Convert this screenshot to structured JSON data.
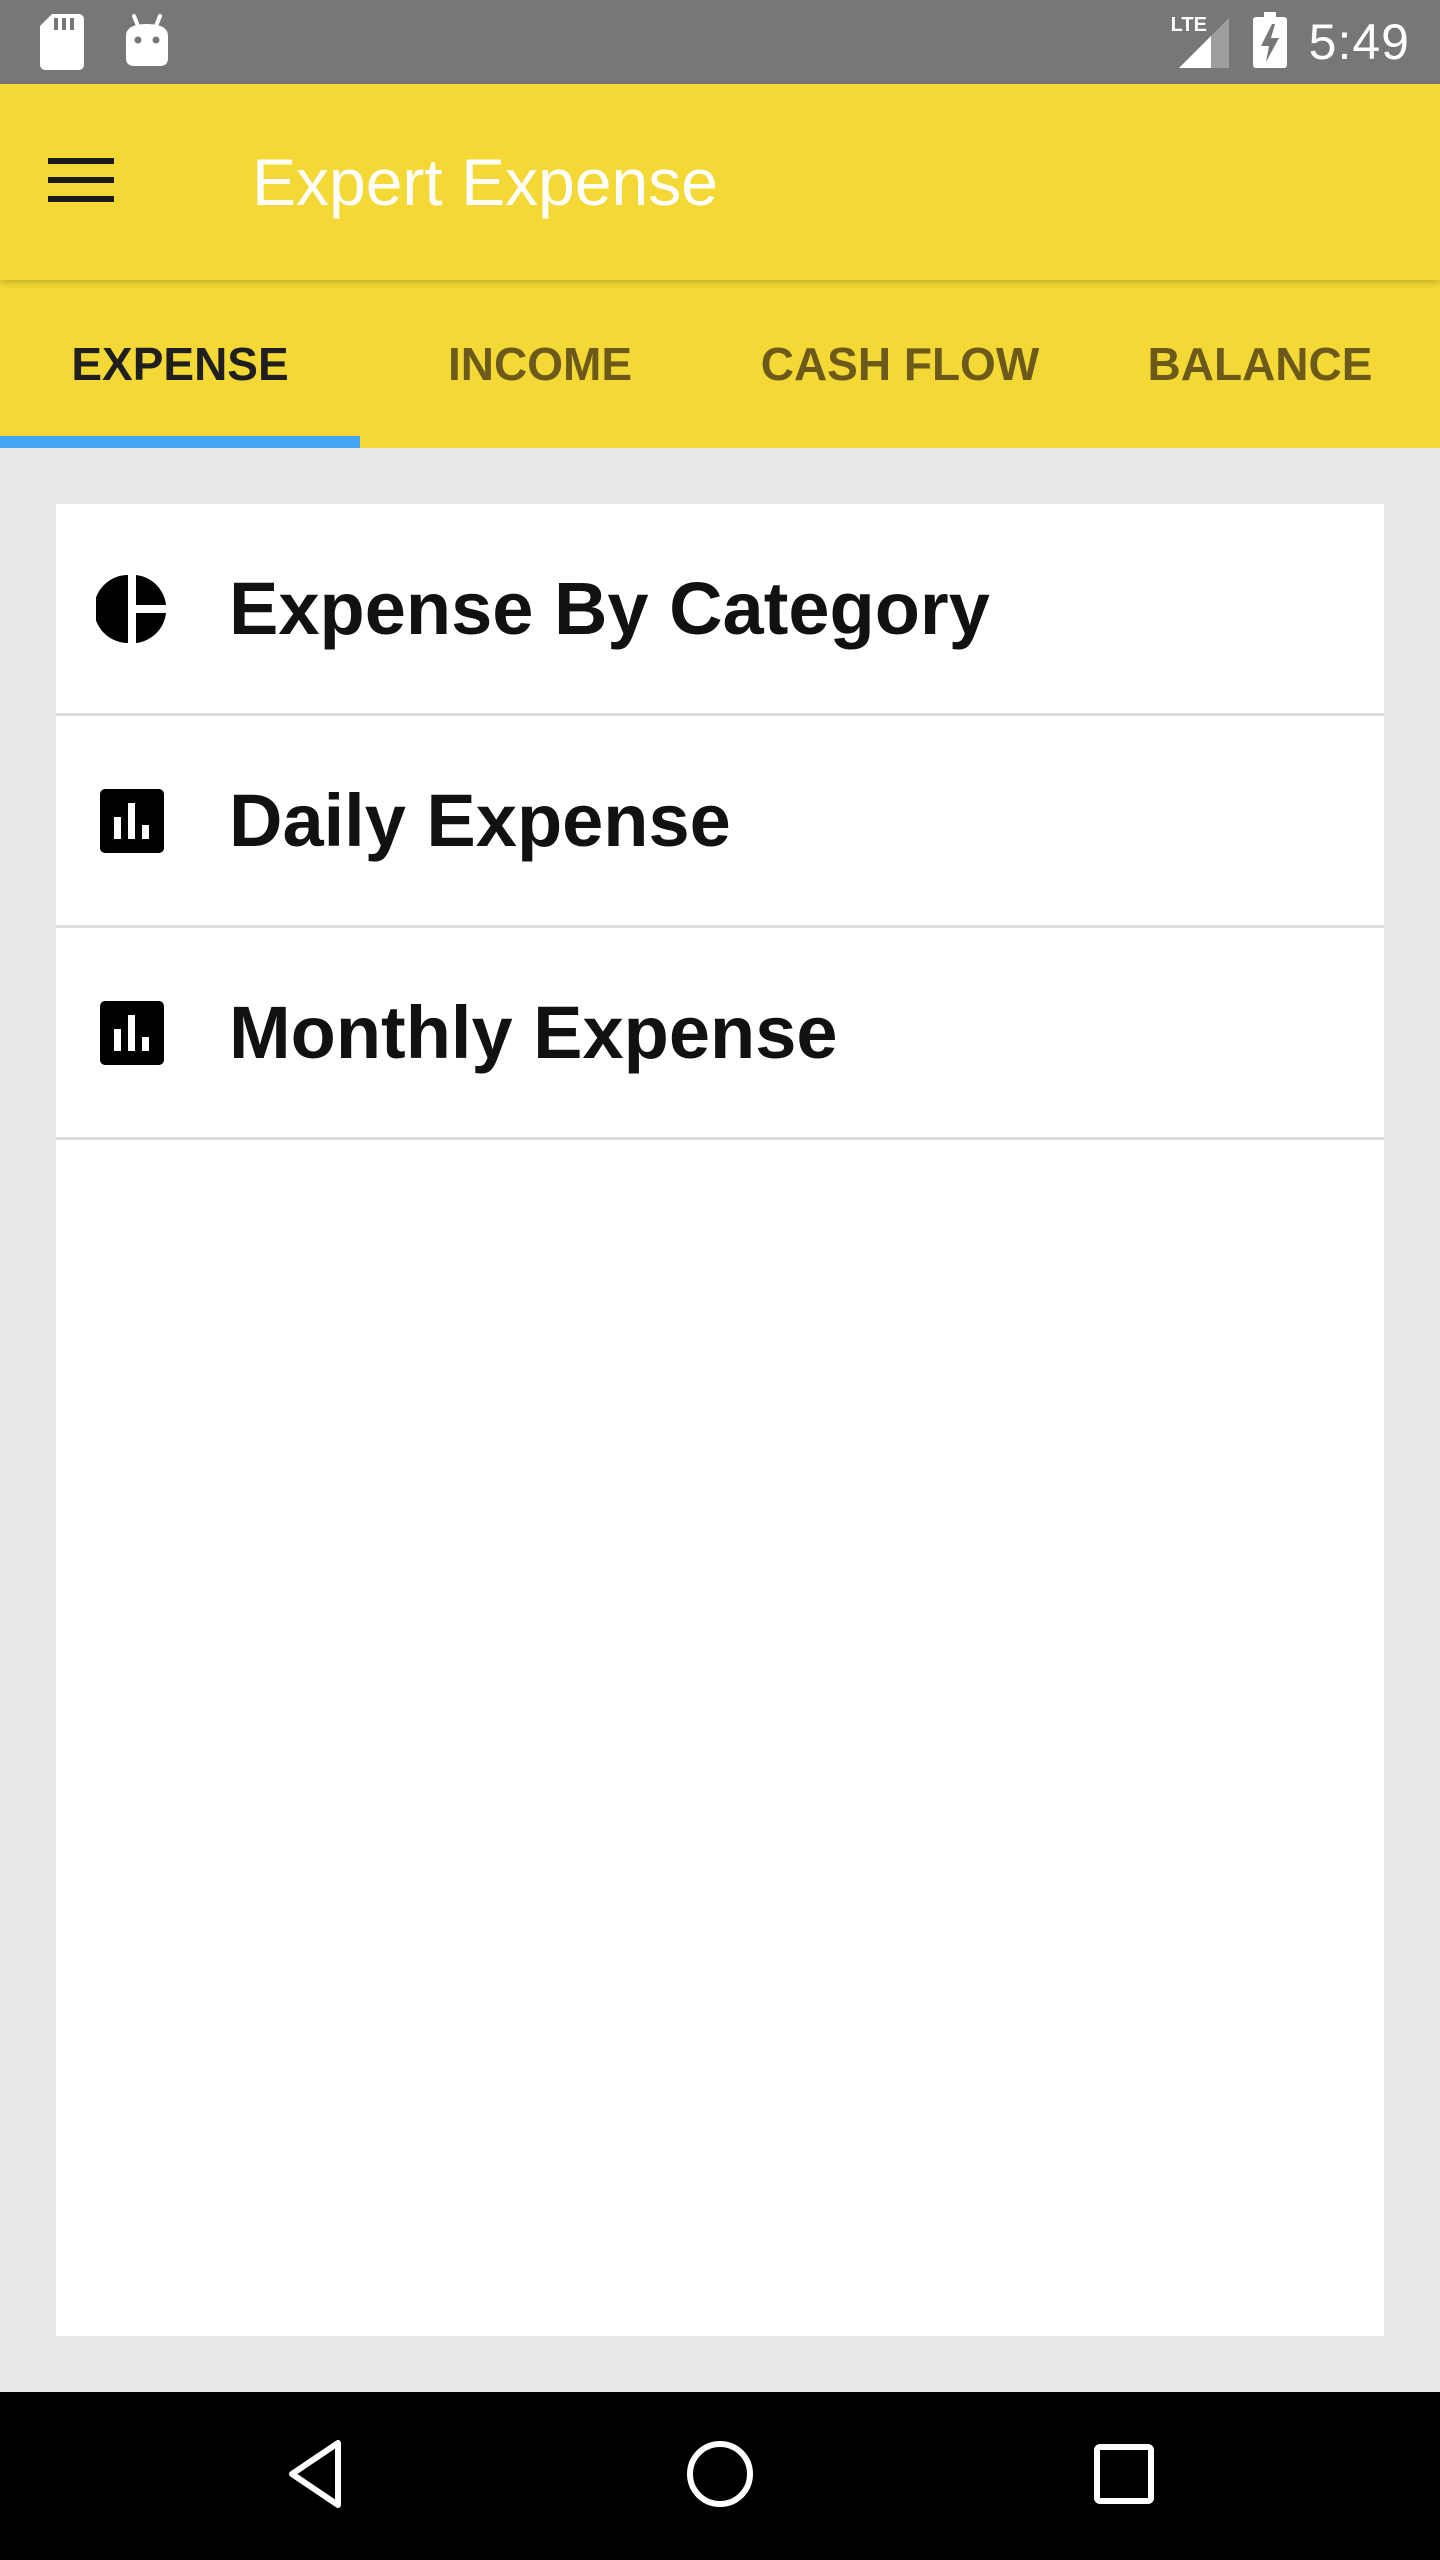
{
  "status_bar": {
    "time": "5:49",
    "network": "LTE",
    "icons": [
      "sd-card-icon",
      "android-icon",
      "signal-icon",
      "battery-charging-icon"
    ]
  },
  "app_bar": {
    "title": "Expert Expense",
    "menu_icon": "menu-icon"
  },
  "tabs": [
    {
      "label": "EXPENSE",
      "active": true
    },
    {
      "label": "INCOME",
      "active": false
    },
    {
      "label": "CASH FLOW",
      "active": false
    },
    {
      "label": "BALANCE",
      "active": false
    }
  ],
  "reports": [
    {
      "label": "Expense By Category",
      "icon": "pie-chart-icon"
    },
    {
      "label": "Daily Expense",
      "icon": "bar-chart-icon"
    },
    {
      "label": "Monthly Expense",
      "icon": "bar-chart-icon"
    }
  ],
  "nav_bar": {
    "buttons": [
      "back-icon",
      "home-icon",
      "recents-icon"
    ]
  },
  "colors": {
    "accent": "#f4d835",
    "tab_indicator": "#42a5f5",
    "status_bar": "#777777"
  }
}
